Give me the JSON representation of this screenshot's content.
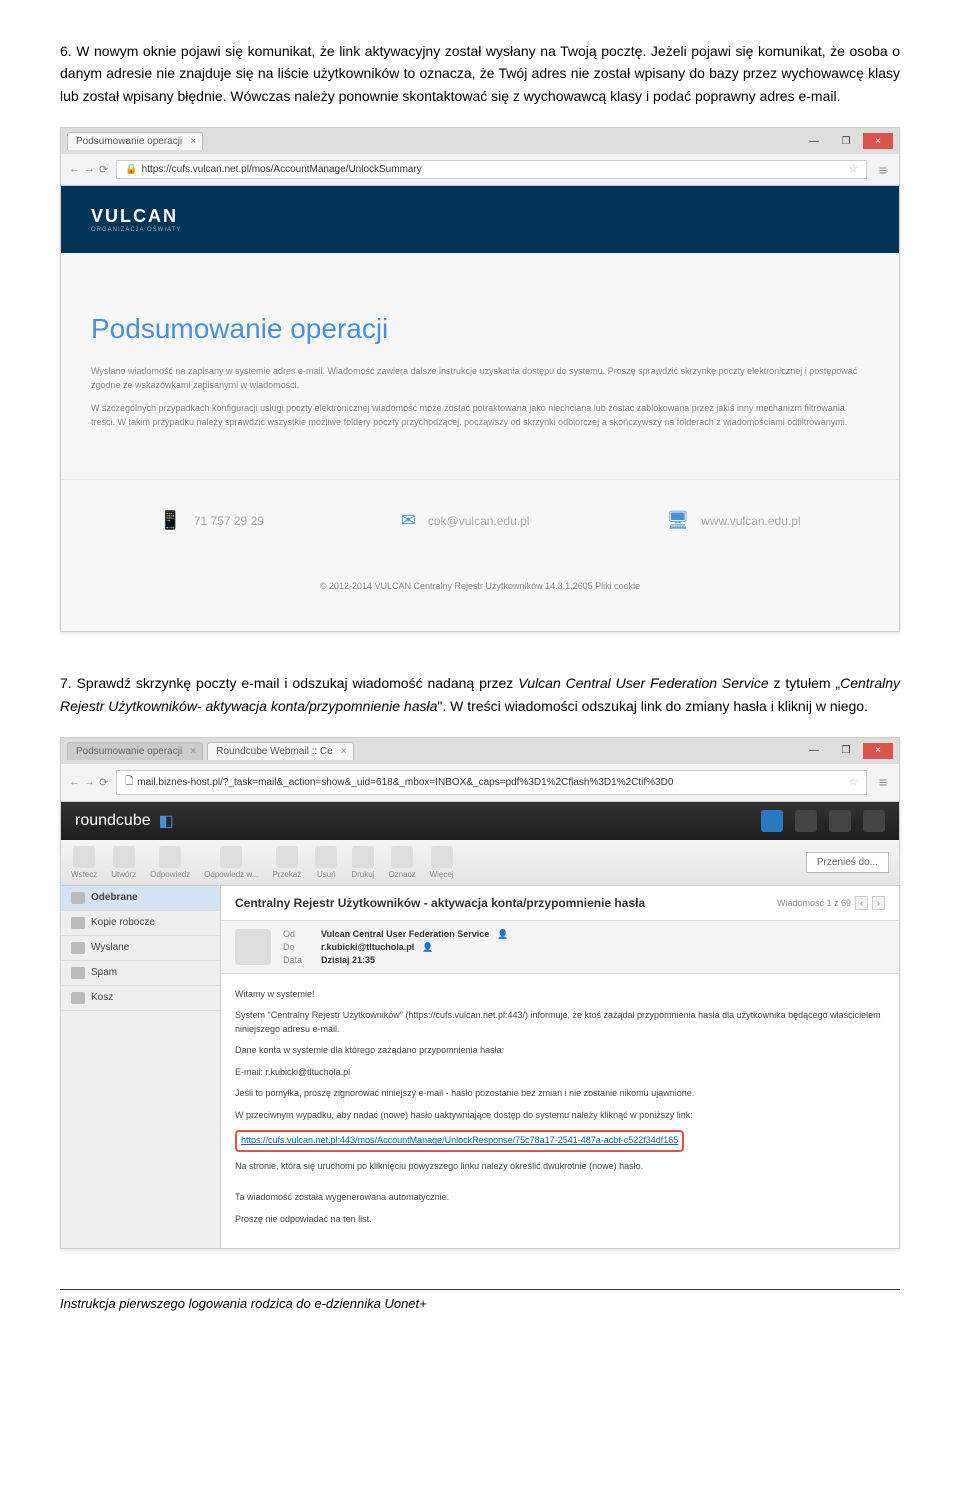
{
  "doc": {
    "para6_num": "6.",
    "para6": "W nowym oknie pojawi się komunikat, że link aktywacyjny został wysłany na Twoją pocztę. Jeżeli pojawi się komunikat, że osoba o danym adresie nie znajduje się na liście użytkowników to oznacza, że Twój adres nie został wpisany do bazy przez wychowawcę klasy lub został wpisany błędnie. Wówczas należy ponownie skontaktować się z wychowawcą klasy i podać poprawny adres e-mail.",
    "para7_num": "7.",
    "para7_a": "Sprawdź skrzynkę poczty e-mail i odszukaj wiadomość nadaną przez ",
    "para7_b": "Vulcan Central User Federation Service",
    "para7_c": " z tytułem „",
    "para7_d": "Centralny Rejestr Użytkowników- aktywacja konta/przypomnienie hasła",
    "para7_e": "\". W treści wiadomości odszukaj link do zmiany hasła i kliknij w niego.",
    "footer": "Instrukcja pierwszego logowania rodzica do e-dziennika Uonet+"
  },
  "vulcan": {
    "tab": "Podsumowanie operacji",
    "url": "https://cufs.vulcan.net.pl/mos/AccountManage/UnlockSummary",
    "logo": "VULCAN",
    "sublogo": "ORGANIZACJA OŚWIATY",
    "title": "Podsumowanie operacji",
    "text1": "Wysłano wiadomość na zapisany w systemie adres e-mail. Wiadomość zawiera dalsze instrukcje uzyskania dostępu do systemu. Proszę sprawdzić skrzynkę poczty elektronicznej i postępować zgodne ze wskazówkami zapisanymi w wiadomości.",
    "text2": "W szczególnych przypadkach konfiguracji usługi poczty elektronicznej wiadomość może zostać potraktowana jako niechciana lub zostać zablokowana przez jakiś inny mechanizm filtrowania treści. W takim przypadku należy sprawdzić wszystkie możliwe foldery poczty przychodzącej, począwszy od skrzynki odbiorczej a skończywszy na folderach z wiadomościami odfiltrowanymi.",
    "phone": "71 757 29 29",
    "email": "cok@vulcan.edu.pl",
    "web": "www.vulcan.edu.pl",
    "copyright": "© 2012-2014 VULCAN Centralny Rejestr Użytkowników 14.3.1.2605 Pliki cookie"
  },
  "rc": {
    "tab1": "Podsumowanie operacji",
    "tab2": "Roundcube Webmail :: Ce",
    "url": "mail.biznes-host.pl/?_task=mail&_action=show&_uid=618&_mbox=INBOX&_caps=pdf%3D1%2Cflash%3D1%2Ctif%3D0",
    "logo": "roundcube",
    "tools": {
      "back": "Wstecz",
      "compose": "Utwórz",
      "reply": "Odpowiedz",
      "replyall": "Odpowiedz w...",
      "forward": "Przekaż",
      "delete": "Usuń",
      "print": "Drukuj",
      "mark": "Oznacz",
      "more": "Więcej"
    },
    "move": "Przenieś do...",
    "folders": {
      "inbox": "Odebrane",
      "drafts": "Kopie robocze",
      "sent": "Wysłane",
      "spam": "Spam",
      "trash": "Kosz"
    },
    "subject": "Centralny Rejestr Użytkowników - aktywacja konta/przypomnienie hasła",
    "pager": "Wiadomość 1 z 69",
    "from_label": "Od",
    "from": "Vulcan Central User Federation Service",
    "to_label": "Do",
    "to": "r.kubicki@tltuchola.pl",
    "date_label": "Data",
    "date": "Dzisiaj 21:35",
    "msg_greet": "Witamy w systemie!",
    "msg_1": "System \"Centralny Rejestr Użytkowników\" (https://cufs.vulcan.net.pl:443/) informuje, że ktoś zażądał przypomnienia hasła dla użytkownika będącego właścicielem niniejszego adresu e-mail.",
    "msg_2": "Dane konta w systemie dla którego zażądano przypomnienia hasła:",
    "msg_email": "E-mail: r.kubicki@tltuchola.pl",
    "msg_3": "Jeśli to pomyłka, proszę zignorować niniejszy e-mail - hasło pozostanie bez zmian i nie zostanie nikomu ujawnione.",
    "msg_4": "W przeciwnym wypadku, aby nadać (nowe) hasło uaktywniające dostęp do systemu należy kliknąć w poniższy link:",
    "msg_link": "https://cufs.vulcan.net.pl:443/mos/AccountManage/UnlockResponse/75c78a17-2541-487a-acbf-c522f34df165",
    "msg_5": "Na stronie, która się uruchomi po kliknięciu powyższego linku należy określić dwukrotnie (nowe) hasło.",
    "msg_6": "Ta wiadomość została wygenerowana automatycznie.",
    "msg_7": "Proszę nie odpowiadać na ten list."
  }
}
